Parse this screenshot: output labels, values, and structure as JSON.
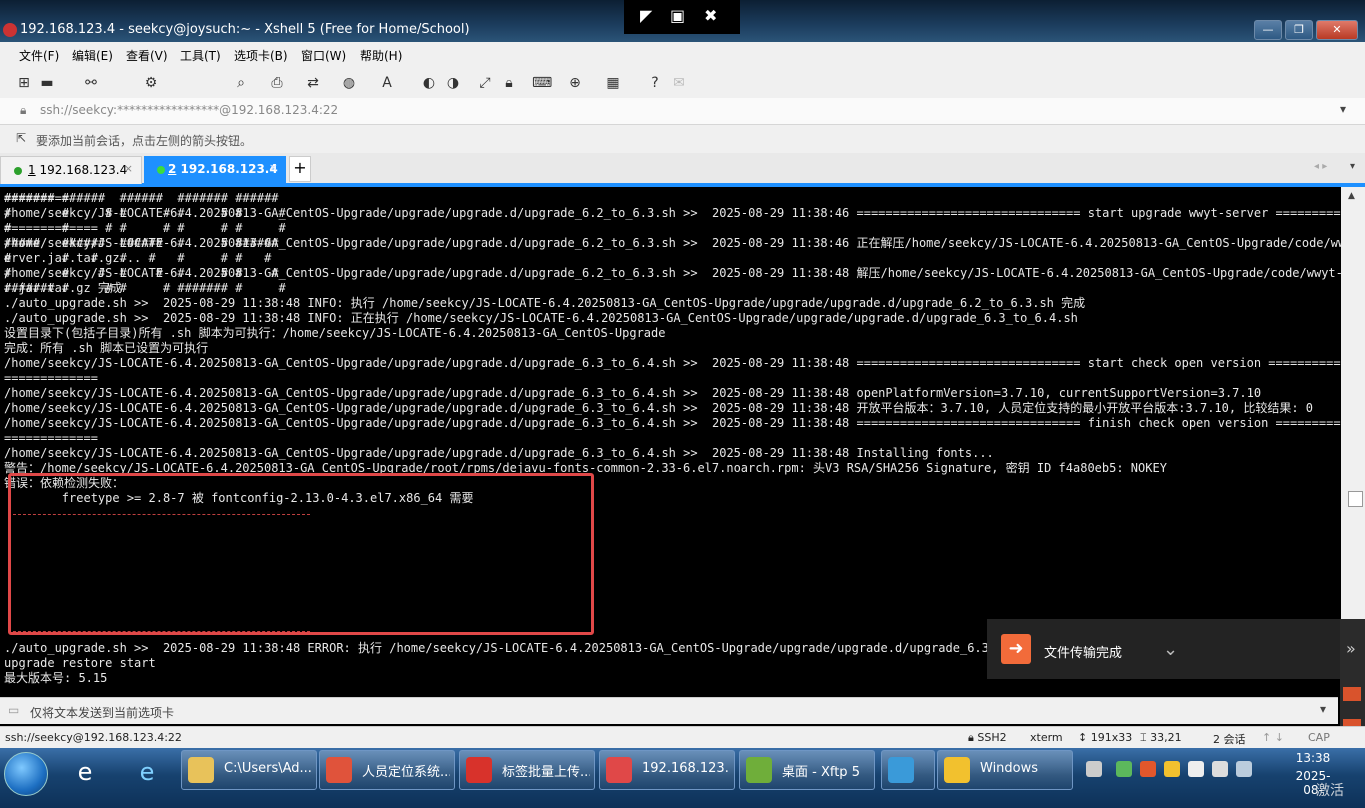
{
  "window": {
    "title": "192.168.123.4 - seekcy@joysuch:~ - Xshell 5 (Free for Home/School)",
    "min_label": "—",
    "max_label": "❐",
    "close_label": "✕"
  },
  "menu": [
    "文件(F)",
    "编辑(E)",
    "查看(V)",
    "工具(T)",
    "选项卡(B)",
    "窗口(W)",
    "帮助(H)"
  ],
  "address": {
    "text": "ssh://seekcy:*****************@192.168.123.4:22"
  },
  "hint": {
    "text": "要添加当前会话，点击左侧的箭头按钮。"
  },
  "tabs": [
    {
      "number": "1",
      "label": "192.168.123.4",
      "active": false
    },
    {
      "number": "2",
      "label": "192.168.123.4",
      "active": true
    }
  ],
  "tab_add": "+",
  "terminal": {
    "text": "=========\n/home/seekcy/JS-LOCATE-6.4.20250813-GA_CentOS-Upgrade/upgrade/upgrade.d/upgrade_6.2_to_6.3.sh >>  2025-08-29 11:38:46 =============================== start upgrade wwyt-server ===============\n=============\n/home/seekcy/JS-LOCATE-6.4.20250813-GA_CentOS-Upgrade/upgrade/upgrade.d/upgrade_6.2_to_6.3.sh >>  2025-08-29 11:38:46 正在解压/home/seekcy/JS-LOCATE-6.4.20250813-GA_CentOS-Upgrade/code/wwyt-s\nerver.jar.tar.gz...\n/home/seekcy/JS-LOCATE-6.4.20250813-GA_CentOS-Upgrade/upgrade/upgrade.d/upgrade_6.2_to_6.3.sh >>  2025-08-29 11:38:48 解压/home/seekcy/JS-LOCATE-6.4.20250813-GA_CentOS-Upgrade/code/wwyt-server\nr.jar.tar.gz 完成\n./auto_upgrade.sh >>  2025-08-29 11:38:48 INFO: 执行 /home/seekcy/JS-LOCATE-6.4.20250813-GA_CentOS-Upgrade/upgrade/upgrade.d/upgrade_6.2_to_6.3.sh 完成\n./auto_upgrade.sh >>  2025-08-29 11:38:48 INFO: 正在执行 /home/seekcy/JS-LOCATE-6.4.20250813-GA_CentOS-Upgrade/upgrade/upgrade.d/upgrade_6.3_to_6.4.sh\n设置目录下(包括子目录)所有 .sh 脚本为可执行：/home/seekcy/JS-LOCATE-6.4.20250813-GA_CentOS-Upgrade\n完成：所有 .sh 脚本已设置为可执行\n/home/seekcy/JS-LOCATE-6.4.20250813-GA_CentOS-Upgrade/upgrade/upgrade.d/upgrade_6.3_to_6.4.sh >>  2025-08-29 11:38:48 =============================== start check open version ===============\n=============\n/home/seekcy/JS-LOCATE-6.4.20250813-GA_CentOS-Upgrade/upgrade/upgrade.d/upgrade_6.3_to_6.4.sh >>  2025-08-29 11:38:48 openPlatformVersion=3.7.10, currentSupportVersion=3.7.10\n/home/seekcy/JS-LOCATE-6.4.20250813-GA_CentOS-Upgrade/upgrade/upgrade.d/upgrade_6.3_to_6.4.sh >>  2025-08-29 11:38:48 开放平台版本：3.7.10, 人员定位支持的最小开放平台版本:3.7.10, 比较结果: 0\n/home/seekcy/JS-LOCATE-6.4.20250813-GA_CentOS-Upgrade/upgrade/upgrade.d/upgrade_6.3_to_6.4.sh >>  2025-08-29 11:38:48 =============================== finish check open version ===============\n=============\n/home/seekcy/JS-LOCATE-6.4.20250813-GA_CentOS-Upgrade/upgrade/upgrade.d/upgrade_6.3_to_6.4.sh >>  2025-08-29 11:38:48 Installing fonts...\n警告：/home/seekcy/JS-LOCATE-6.4.20250813-GA_CentOS-Upgrade/root/rpms/dejavu-fonts-common-2.33-6.el7.noarch.rpm: 头V3 RSA/SHA256 Signature, 密钥 ID f4a80eb5: NOKEY\n错误：依赖检测失败：\n        freetype >= 2.8-7 被 fontconfig-2.13.0-4.3.el7.x86_64 需要\n\n\n\n\n\n\n\n\n\n./auto_upgrade.sh >>  2025-08-29 11:38:48 ERROR: 执行 /home/seekcy/JS-LOCATE-6.4.20250813-GA_CentOS-Upgrade/upgrade/upgrade.d/upgrade_6.3_to_\nupgrade restore start\n最大版本号: 5.15",
    "ascii_error": "####### ######  ######  ####### ######\n#       #     # #     # #     # #     #\n#       #     # #     # #     # #     #\n#####   ######  ######  #     # ######\n#       #   #   #   #   #     # #   #\n#       #    #  #    #  #     # #    #\n####### #     # #     # ####### #     #"
  },
  "toast": {
    "text": "文件传输完成"
  },
  "sendbar": {
    "placeholder": "仅将文本发送到当前选项卡"
  },
  "status": {
    "connection": "ssh://seekcy@192.168.123.4:22",
    "protocol": "SSH2",
    "term": "xterm",
    "size": "191x33",
    "cursor": "33,21",
    "sessions": "2 会话",
    "caps": "CAP"
  },
  "taskbar": {
    "items": [
      {
        "label": "C:\\Users\\Ad...",
        "icon": "folder-icon",
        "color": "#e8c25a"
      },
      {
        "label": "人员定位系统...",
        "icon": "chrome-icon",
        "color": "#e0533b"
      },
      {
        "label": "标签批量上传...",
        "icon": "wps-icon",
        "color": "#d8322b"
      },
      {
        "label": "192.168.123...",
        "icon": "xshell-icon",
        "color": "#e04848"
      },
      {
        "label": "桌面 - Xftp 5",
        "icon": "xftp-icon",
        "color": "#6fae3a"
      },
      {
        "label": "",
        "icon": "app-grid-icon",
        "color": "#3a9ad9"
      },
      {
        "label": "Windows",
        "icon": "warning-icon",
        "color": "#f2c12e"
      }
    ],
    "time": "13:38",
    "date": "2025-08-",
    "corner_text": "激活"
  }
}
